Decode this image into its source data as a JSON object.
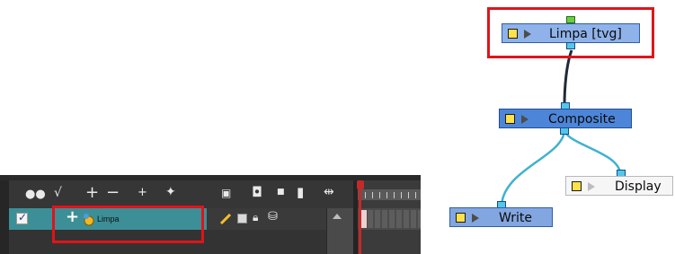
{
  "timeline": {
    "layer_name": "Limpa",
    "layer_checked": true,
    "toolbar_icons": [
      "onion-skin-icon",
      "add-drawing-layer-icon",
      "add-layer-icon",
      "remove-layer-icon",
      "add-peg-icon",
      "add-effect-icon",
      "camera-icon",
      "show-icon",
      "dot-icon",
      "rectangle-icon",
      "expand-icon"
    ],
    "row_icons": [
      "pencil-icon",
      "color-swatch-icon",
      "lock-icon",
      "database-icon"
    ]
  },
  "nodes": {
    "limpa": {
      "label": "Limpa  [tvg]"
    },
    "composite": {
      "label": "Composite"
    },
    "display": {
      "label": "Display"
    },
    "write": {
      "label": "Write"
    }
  },
  "colors": {
    "highlight": "#e0141a",
    "layer_selected": "#3c8f97",
    "node_selected": "#8fb2ea",
    "node_composite": "#4d86d8",
    "node_write": "#82a6e0",
    "node_display": "#f6f6f6"
  }
}
